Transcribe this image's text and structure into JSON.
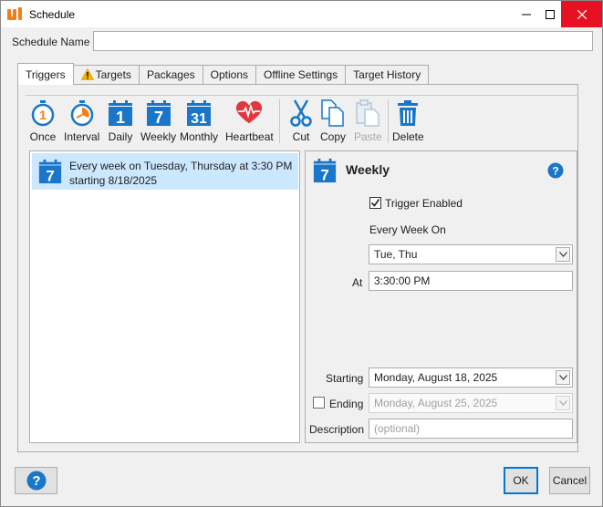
{
  "window": {
    "title": "Schedule",
    "controls": {
      "minimize": "minimize-icon",
      "maximize": "maximize-icon",
      "close": "close-icon"
    }
  },
  "form": {
    "schedule_name_label": "Schedule Name",
    "schedule_name_value": ""
  },
  "tabs": [
    {
      "label": "Triggers",
      "active": true
    },
    {
      "label": "Targets",
      "icon": "warning-icon"
    },
    {
      "label": "Packages"
    },
    {
      "label": "Options"
    },
    {
      "label": "Offline Settings"
    },
    {
      "label": "Target History"
    }
  ],
  "toolbar": {
    "once": "Once",
    "interval": "Interval",
    "daily": "Daily",
    "weekly": "Weekly",
    "monthly": "Monthly",
    "heartbeat": "Heartbeat",
    "cut": "Cut",
    "copy": "Copy",
    "paste": "Paste",
    "delete": "Delete",
    "daily_number": "1",
    "weekly_number": "7",
    "monthly_number": "31"
  },
  "trigger_list": [
    {
      "line1": "Every week on Tuesday, Thursday at 3:30 PM",
      "line2": "starting 8/18/2025",
      "icon_number": "7"
    }
  ],
  "detail": {
    "title": "Weekly",
    "icon_number": "7",
    "trigger_enabled_label": "Trigger Enabled",
    "trigger_enabled": true,
    "every_week_on_label": "Every Week On",
    "days_value": "Tue, Thu",
    "at_label": "At",
    "time_value": "3:30:00 PM",
    "starting_label": "Starting",
    "starting_value": "Monday, August 18, 2025",
    "ending_label": "Ending",
    "ending_enabled": false,
    "ending_value": "Monday, August 25, 2025",
    "description_label": "Description",
    "description_placeholder": "(optional)"
  },
  "footer": {
    "ok": "OK",
    "cancel": "Cancel"
  },
  "colors": {
    "accent_blue": "#1976c8",
    "orange": "#f07f1a",
    "heart_red": "#e0383e",
    "selection": "#cce8ff",
    "close_red": "#e81123"
  }
}
